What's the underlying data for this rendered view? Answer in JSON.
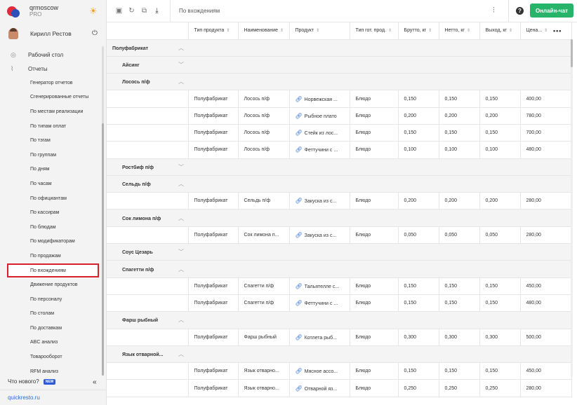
{
  "brand": {
    "name": "qrmoscow",
    "plan": "PRO"
  },
  "user": {
    "name": "Кирилл Рестов"
  },
  "menu": {
    "desktop": "Рабочий стол",
    "reports": "Отчеты",
    "subitems": [
      "Генератор отчетов",
      "Сгенерированные отчеты",
      "По местам реализации",
      "По типам оплат",
      "По тэгам",
      "По группам",
      "По дням",
      "По часам",
      "По официантам",
      "По кассирам",
      "По блюдам",
      "По модификаторам",
      "По продажам",
      "По вхождениям",
      "Движение продуктов",
      "По персоналу",
      "По столам",
      "По доставкам",
      "ABC анализ",
      "Товарооборот",
      "RFM анализ"
    ],
    "active_index": 13
  },
  "whats_new": {
    "label": "Что нового?",
    "badge": "NEW"
  },
  "footer": {
    "link": "quickresto.ru"
  },
  "toolbar": {
    "title": "По вхождениям",
    "chat_button": "Онлайн-чат"
  },
  "columns": [
    "Тип продукта",
    "Наименование",
    "Продукт",
    "Тип гот. прод.",
    "Брутто, кг",
    "Нетто, кг",
    "Выход, кг",
    "Цена..."
  ],
  "top_group": "Полуфабрикат",
  "groups": [
    {
      "name": "Айсинг",
      "expanded": false,
      "rows": []
    },
    {
      "name": "Лосось п/ф",
      "expanded": true,
      "rows": [
        [
          "Полуфабрикат",
          "Лосось п/ф",
          "Норвежская ...",
          "Блюдо",
          "0,150",
          "0,150",
          "0,150",
          "400,00"
        ],
        [
          "Полуфабрикат",
          "Лосось п/ф",
          "Рыбное плато",
          "Блюдо",
          "0,200",
          "0,200",
          "0,200",
          "780,00"
        ],
        [
          "Полуфабрикат",
          "Лосось п/ф",
          "Стейк из лос...",
          "Блюдо",
          "0,150",
          "0,150",
          "0,150",
          "700,00"
        ],
        [
          "Полуфабрикат",
          "Лосось п/ф",
          "Феттучини с ...",
          "Блюдо",
          "0,100",
          "0,100",
          "0,100",
          "480,00"
        ]
      ]
    },
    {
      "name": "Ростбиф п/ф",
      "expanded": false,
      "rows": []
    },
    {
      "name": "Сельдь п/ф",
      "expanded": true,
      "rows": [
        [
          "Полуфабрикат",
          "Сельдь п/ф",
          "Закуска из с...",
          "Блюдо",
          "0,200",
          "0,200",
          "0,200",
          "280,00"
        ]
      ]
    },
    {
      "name": "Сок лимона п/ф",
      "expanded": true,
      "rows": [
        [
          "Полуфабрикат",
          "Сок лимона п...",
          "Закуска из с...",
          "Блюдо",
          "0,050",
          "0,050",
          "0,050",
          "280,00"
        ]
      ]
    },
    {
      "name": "Соус Цезарь",
      "expanded": false,
      "rows": []
    },
    {
      "name": "Спагетти п/ф",
      "expanded": true,
      "rows": [
        [
          "Полуфабрикат",
          "Спагетти п/ф",
          "Тальятелле с...",
          "Блюдо",
          "0,150",
          "0,150",
          "0,150",
          "450,00"
        ],
        [
          "Полуфабрикат",
          "Спагетти п/ф",
          "Феттучини с ...",
          "Блюдо",
          "0,150",
          "0,150",
          "0,150",
          "480,00"
        ]
      ]
    },
    {
      "name": "Фарш рыбный",
      "expanded": true,
      "rows": [
        [
          "Полуфабрикат",
          "Фарш рыбный",
          "Котлета рыб...",
          "Блюдо",
          "0,300",
          "0,300",
          "0,300",
          "500,00"
        ]
      ]
    },
    {
      "name": "Язык отварной...",
      "expanded": true,
      "rows": [
        [
          "Полуфабрикат",
          "Язык отварно...",
          "Мясное ассо...",
          "Блюдо",
          "0,150",
          "0,150",
          "0,150",
          "450,00"
        ],
        [
          "Полуфабрикат",
          "Язык отварно...",
          "Отварной яз...",
          "Блюдо",
          "0,250",
          "0,250",
          "0,250",
          "280,00"
        ]
      ]
    }
  ]
}
